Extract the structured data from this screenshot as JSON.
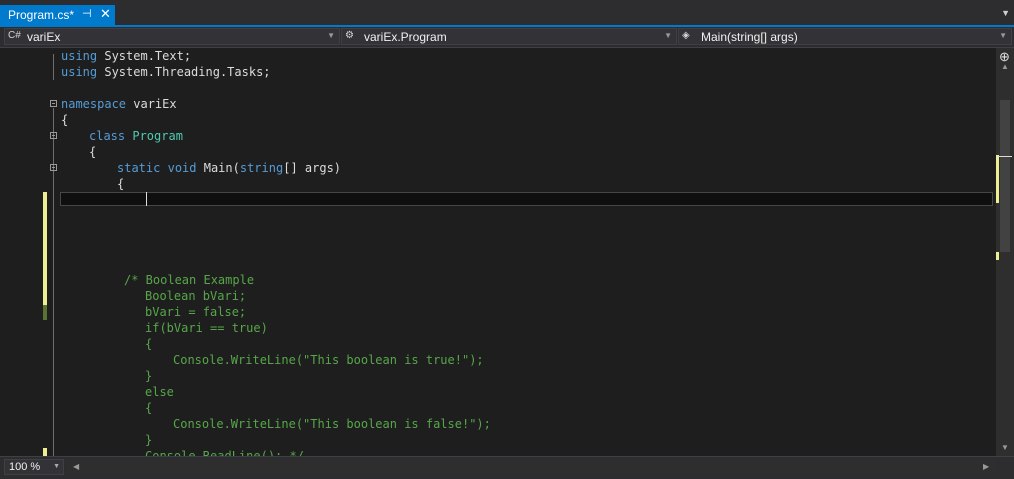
{
  "tab": {
    "title": "Program.cs*",
    "pin_icon": "pin-icon",
    "close_icon": "close-icon"
  },
  "overflow_icon": "chevron-down-icon",
  "nav": {
    "project": "variEx",
    "class_name": "variEx.Program",
    "member": "Main(string[] args)"
  },
  "colors": {
    "accent": "#007acc",
    "keyword": "#569cd6",
    "type": "#4ec9b0",
    "comment": "#57a64a",
    "change_saved": "#577430",
    "change_unsaved": "#efef91"
  },
  "code": {
    "l1_kw": "using",
    "l1_rest": " System.Text;",
    "l2_kw": "using",
    "l2_rest": " System.Threading.Tasks;",
    "l3_kw": "namespace",
    "l3_rest": " variEx",
    "l4": "{",
    "l5_kw": "class",
    "l5_type": "Program",
    "l6": "{",
    "l7_kw1": "static",
    "l7_kw2": "void",
    "l7_mid": "Main(",
    "l7_kw3": "string",
    "l7_end": "[] args)",
    "l8": "{",
    "c1": "/* Boolean Example",
    "c2": "Boolean bVari;",
    "c3": "bVari = false;",
    "c4": "if(bVari == true)",
    "c5": "{",
    "c6": "Console.WriteLine(\"This boolean is true!\");",
    "c7": "}",
    "c8": "else",
    "c9": "{",
    "c10": "Console.WriteLine(\"This boolean is false!\");",
    "c11": "}",
    "c12": "Console.ReadLine(); */"
  },
  "status": {
    "zoom": "100 %"
  }
}
